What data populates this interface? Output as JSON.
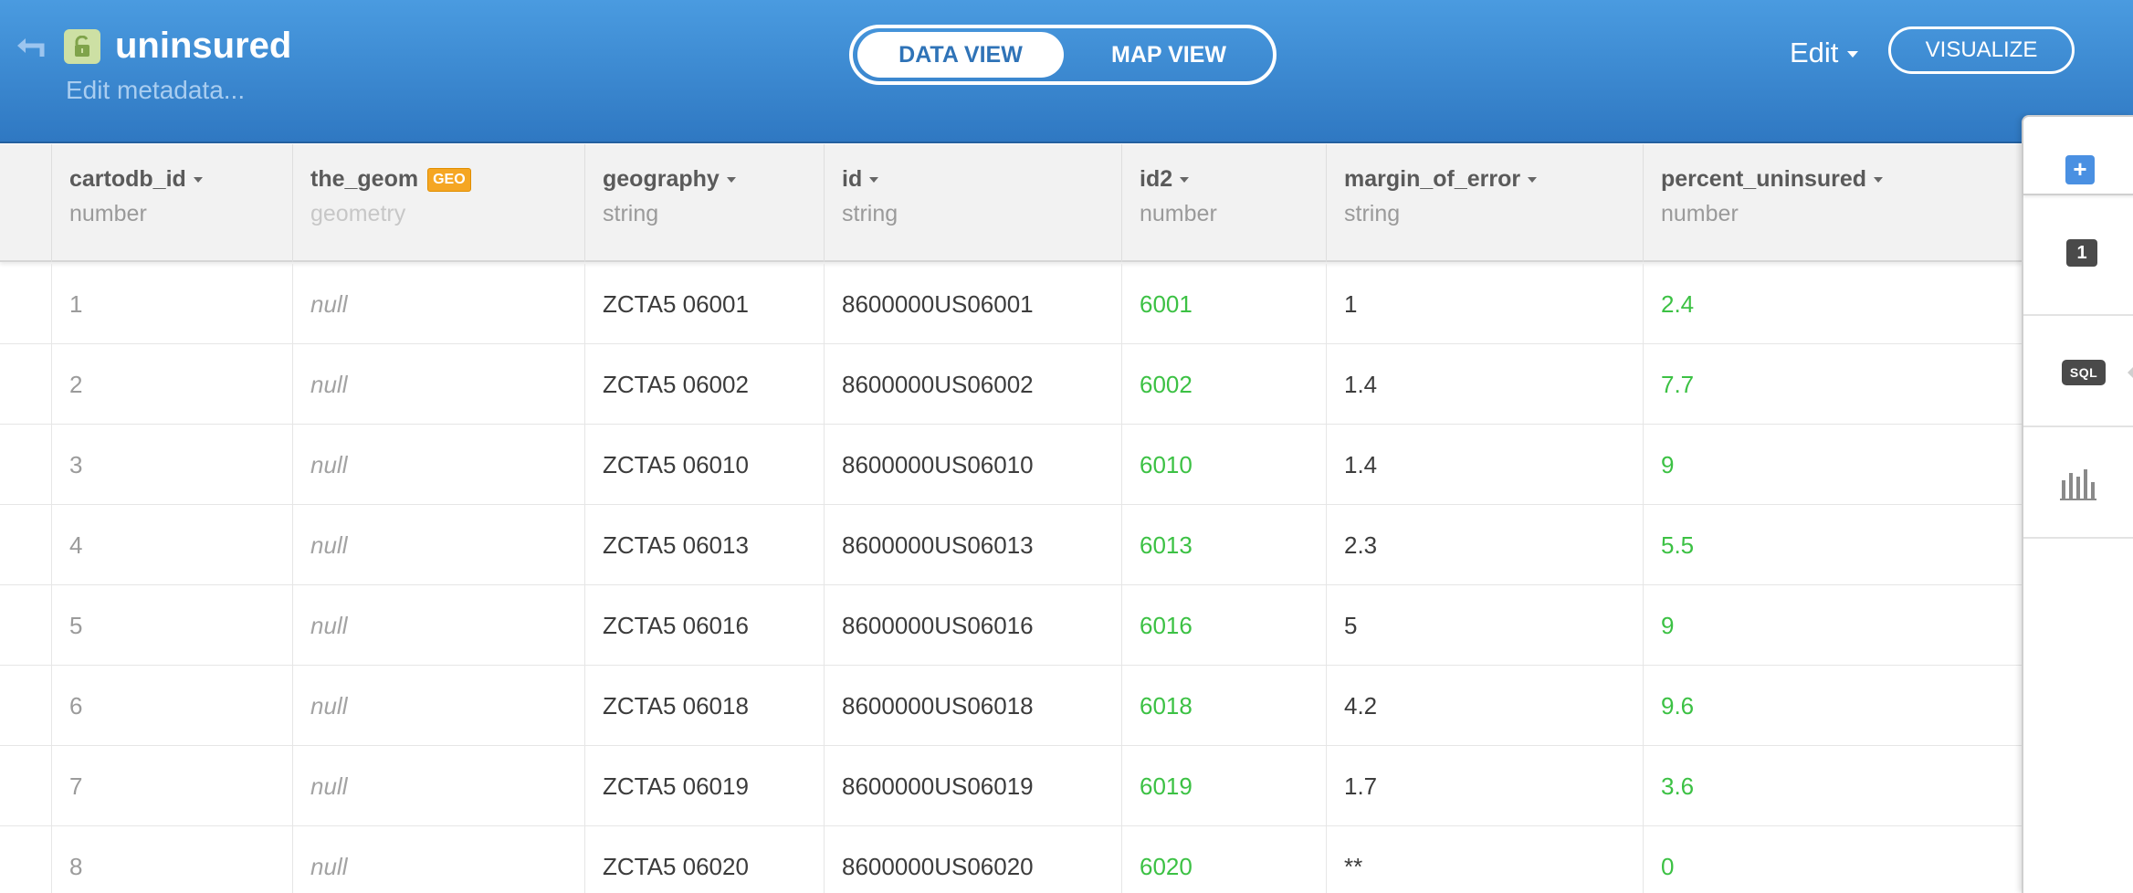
{
  "header": {
    "table_title": "uninsured",
    "edit_metadata": "Edit metadata...",
    "view_tabs": {
      "data_view": "DATA VIEW",
      "map_view": "MAP VIEW"
    },
    "edit_menu": "Edit",
    "visualize_label": "VISUALIZE",
    "colors": {
      "header_top": "#4a9be0",
      "header_bottom": "#2f78c2",
      "privacy_badge": "#cde0a4"
    }
  },
  "table": {
    "columns": [
      {
        "name": "cartodb_id",
        "type": "number"
      },
      {
        "name": "the_geom",
        "type": "geometry",
        "badge": "GEO"
      },
      {
        "name": "geography",
        "type": "string"
      },
      {
        "name": "id",
        "type": "string"
      },
      {
        "name": "id2",
        "type": "number"
      },
      {
        "name": "margin_of_error",
        "type": "string"
      },
      {
        "name": "percent_uninsured",
        "type": "number"
      }
    ],
    "rows": [
      [
        "1",
        "null",
        "ZCTA5 06001",
        "8600000US06001",
        "6001",
        "1",
        "2.4"
      ],
      [
        "2",
        "null",
        "ZCTA5 06002",
        "8600000US06002",
        "6002",
        "1.4",
        "7.7"
      ],
      [
        "3",
        "null",
        "ZCTA5 06010",
        "8600000US06010",
        "6010",
        "1.4",
        "9"
      ],
      [
        "4",
        "null",
        "ZCTA5 06013",
        "8600000US06013",
        "6013",
        "2.3",
        "5.5"
      ],
      [
        "5",
        "null",
        "ZCTA5 06016",
        "8600000US06016",
        "6016",
        "5",
        "9"
      ],
      [
        "6",
        "null",
        "ZCTA5 06018",
        "8600000US06018",
        "6018",
        "4.2",
        "9.6"
      ],
      [
        "7",
        "null",
        "ZCTA5 06019",
        "8600000US06019",
        "6019",
        "1.7",
        "3.6"
      ],
      [
        "8",
        "null",
        "ZCTA5 06020",
        "8600000US06020",
        "6020",
        "**",
        "0"
      ]
    ],
    "colors": {
      "number_value": "#3cc144"
    }
  },
  "side_panel": {
    "add_icon": "plus-icon",
    "layer_count": "1",
    "sql_label": "SQL",
    "chart_icon": "bar-chart-icon"
  }
}
